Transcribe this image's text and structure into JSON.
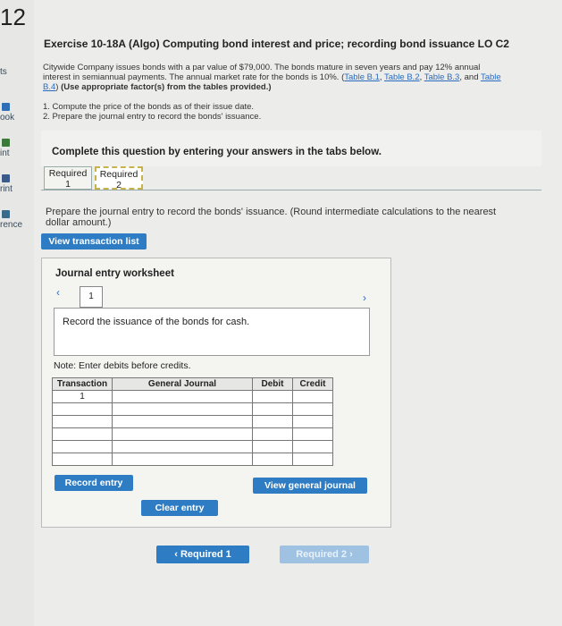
{
  "sidebar": {
    "number": "12",
    "items": [
      "ts",
      "ook",
      "int",
      "rint",
      "rence"
    ]
  },
  "exercise": {
    "title": "Exercise 10-18A (Algo) Computing bond interest and price; recording bond issuance LO C2",
    "line1": "Citywide Company issues bonds with a par value of $79,000. The bonds mature in seven years and pay 12% annual",
    "line2_text": "interest in semiannual payments. The annual market rate for the bonds is 10%.",
    "links": [
      "Table B.1",
      "Table B.2",
      "Table B.3",
      "Table"
    ],
    "line3_link": "B.4",
    "line3_text": "(Use appropriate factor(s) from the tables provided.)",
    "tasks": [
      "1. Compute the price of the bonds as of their issue date.",
      "2. Prepare the journal entry to record the bonds' issuance."
    ]
  },
  "instructions": "Complete this question by entering your answers in the tabs below.",
  "tabs": [
    {
      "label": "Required",
      "num": "1"
    },
    {
      "label": "Required",
      "num": "2"
    }
  ],
  "prompt": "Prepare the journal entry to record the bonds' issuance. (Round intermediate calculations to the nearest dollar amount.)",
  "buttons": {
    "view_transaction_list": "View transaction list",
    "record_entry": "Record entry",
    "view_general_journal": "View general journal",
    "clear_entry": "Clear entry"
  },
  "worksheet": {
    "title": "Journal entry worksheet",
    "page": "1",
    "description": "Record the issuance of the bonds for cash.",
    "note": "Note: Enter debits before credits.",
    "columns": [
      "Transaction",
      "General Journal",
      "Debit",
      "Credit"
    ],
    "rows": [
      [
        "1",
        "",
        "",
        ""
      ],
      [
        "",
        "",
        "",
        ""
      ],
      [
        "",
        "",
        "",
        ""
      ],
      [
        "",
        "",
        "",
        ""
      ],
      [
        "",
        "",
        "",
        ""
      ],
      [
        "",
        "",
        "",
        ""
      ]
    ]
  },
  "nav": {
    "prev": "Required 1",
    "next": "Required 2"
  }
}
